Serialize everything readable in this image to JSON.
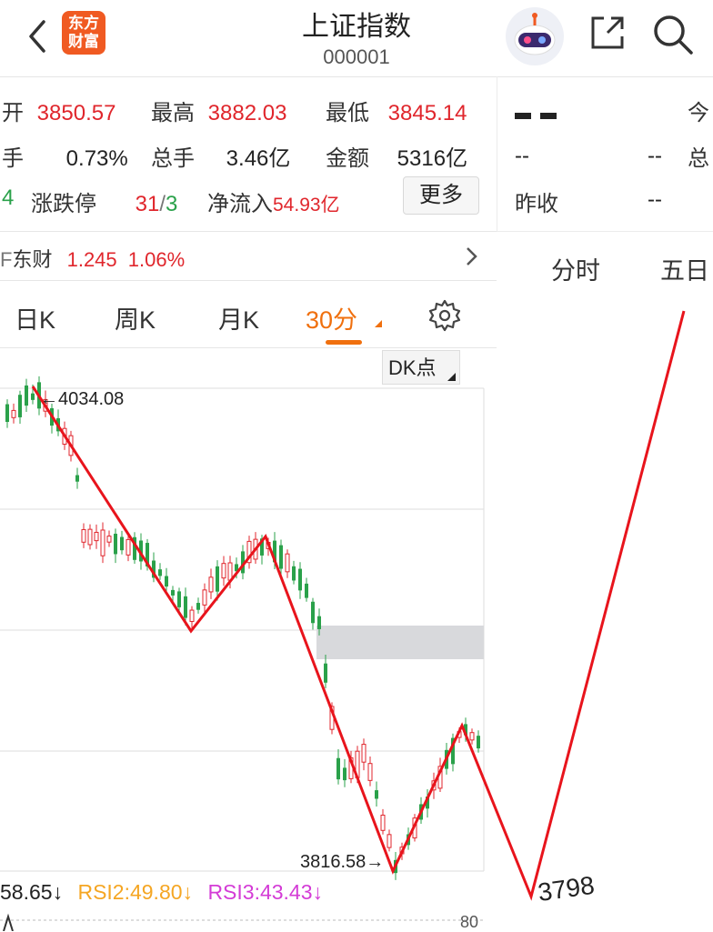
{
  "header": {
    "title": "上证指数",
    "code": "000001",
    "logo_line1": "东方",
    "logo_line2": "财富",
    "colors": {
      "logo": "#f05a22",
      "red": "#e0262c",
      "green": "#2aa14a"
    }
  },
  "quote": {
    "open_label": "开",
    "open_value": "3850.57",
    "high_label": "最高",
    "high_value": "3882.03",
    "low_label": "最低",
    "low_value": "3845.14",
    "turnover_label": "手",
    "turnover_value": "0.73%",
    "volume_label": "总手",
    "volume_value": "3.46亿",
    "amount_label": "金额",
    "amount_value": "5316亿",
    "adv_count": "4",
    "limit_label": "涨跌停",
    "limit_up": "31",
    "limit_sep": "/",
    "limit_down": "3",
    "netflow_label": "净流入",
    "netflow_value": "54.93亿",
    "more_button": "更多"
  },
  "right_panel": {
    "big_dash": "▬ ▬",
    "today_label": "今",
    "dash1": "--",
    "dash2": "--",
    "total_label": "总",
    "prev_close_label": "昨收",
    "prev_close_value": "--",
    "tabs": [
      "分时",
      "五日"
    ]
  },
  "stock_row": {
    "name": "东财",
    "price": "1.245",
    "change": "1.06%",
    "prefix": "F"
  },
  "kline_tabs": [
    "日K",
    "周K",
    "月K",
    "30分"
  ],
  "dk_button": "DK点",
  "annotations": {
    "high": "←4034.08",
    "low": "3816.58→",
    "projection": "3798"
  },
  "rsi": {
    "rsi1": "58.65",
    "rsi1_arrow": "↓",
    "rsi2": "RSI2:49.80",
    "rsi2_arrow": "↓",
    "rsi3": "RSI3:43.43",
    "rsi3_arrow": "↓"
  },
  "bottom_label": "80"
}
